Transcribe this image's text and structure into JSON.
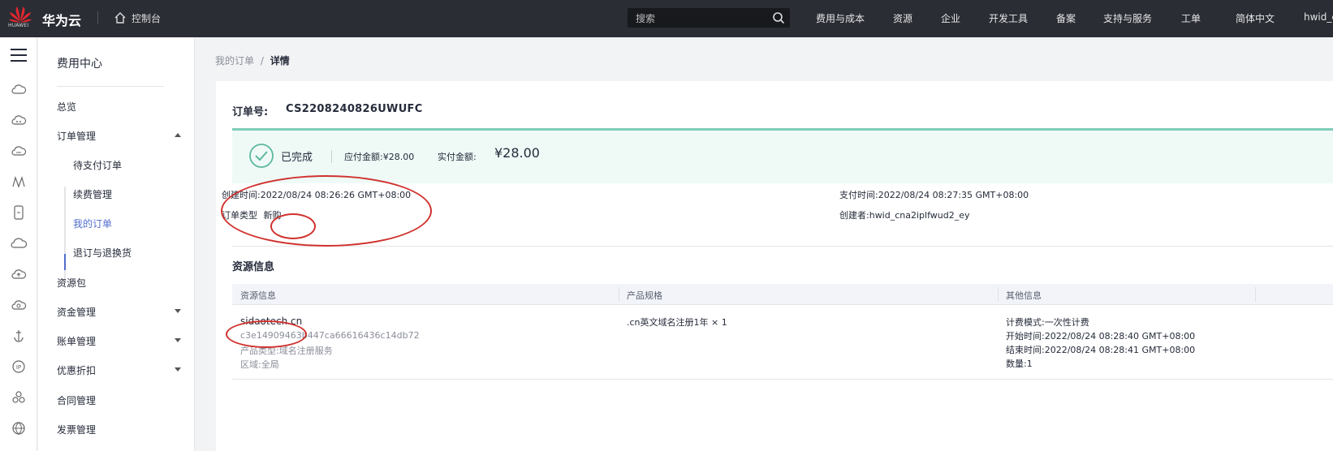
{
  "header": {
    "logo_text": "HUAWEI",
    "brand": "华为云",
    "console": "控制台",
    "search_placeholder": "搜索",
    "nav": [
      "费用与成本",
      "资源",
      "企业",
      "开发工具",
      "备案",
      "支持与服务",
      "工单",
      "简体中文",
      "hwid_c"
    ]
  },
  "sidebar": {
    "title": "费用中心",
    "items": [
      {
        "label": "总览"
      },
      {
        "label": "订单管理",
        "caret": "up"
      },
      {
        "label": "待支付订单"
      },
      {
        "label": "续费管理"
      },
      {
        "label": "我的订单",
        "active": true
      },
      {
        "label": "退订与退换货"
      },
      {
        "label": "资源包"
      },
      {
        "label": "资金管理",
        "caret": "down"
      },
      {
        "label": "账单管理",
        "caret": "down"
      },
      {
        "label": "优惠折扣",
        "caret": "down"
      },
      {
        "label": "合同管理"
      },
      {
        "label": "发票管理"
      }
    ]
  },
  "breadcrumb": {
    "parent": "我的订单",
    "sep": "/",
    "current": "详情"
  },
  "order": {
    "label": "订单号:",
    "number": "CS2208240826UWUFC",
    "status": "已完成",
    "due_label": "应付金额:¥28.00",
    "paid_label": "实付金额:",
    "paid_value": "¥28.00",
    "created_label": "创建时间:",
    "created_value": "2022/08/24 08:26:26 GMT+08:00",
    "type_label": "订单类型",
    "type_value": "新购",
    "paid_time_label": "支付时间:",
    "paid_time_value": "2022/08/24 08:27:35 GMT+08:00",
    "creator_label": "创建者:",
    "creator_value": "hwid_cna2iplfwud2_ey"
  },
  "resources": {
    "title": "资源信息",
    "headers": [
      "资源信息",
      "产品规格",
      "其他信息"
    ],
    "row": {
      "name": "sidaotech.cn",
      "id": "c3e14909463b447ca66616436c14db72",
      "product_type": "产品类型:域名注册服务",
      "region": "区域:全局",
      "spec": ".cn英文域名注册1年 × 1",
      "billing": "计费模式:一次性计费",
      "start": "开始时间:2022/08/24 08:28:40 GMT+08:00",
      "end": "结束时间:2022/08/24 08:28:41 GMT+08:00",
      "quantity": "数量:1"
    }
  },
  "colors": {
    "topbar": "#2a2d34",
    "accent": "#526ecc",
    "success": "#5cb89d",
    "annotation": "#d0312d"
  }
}
